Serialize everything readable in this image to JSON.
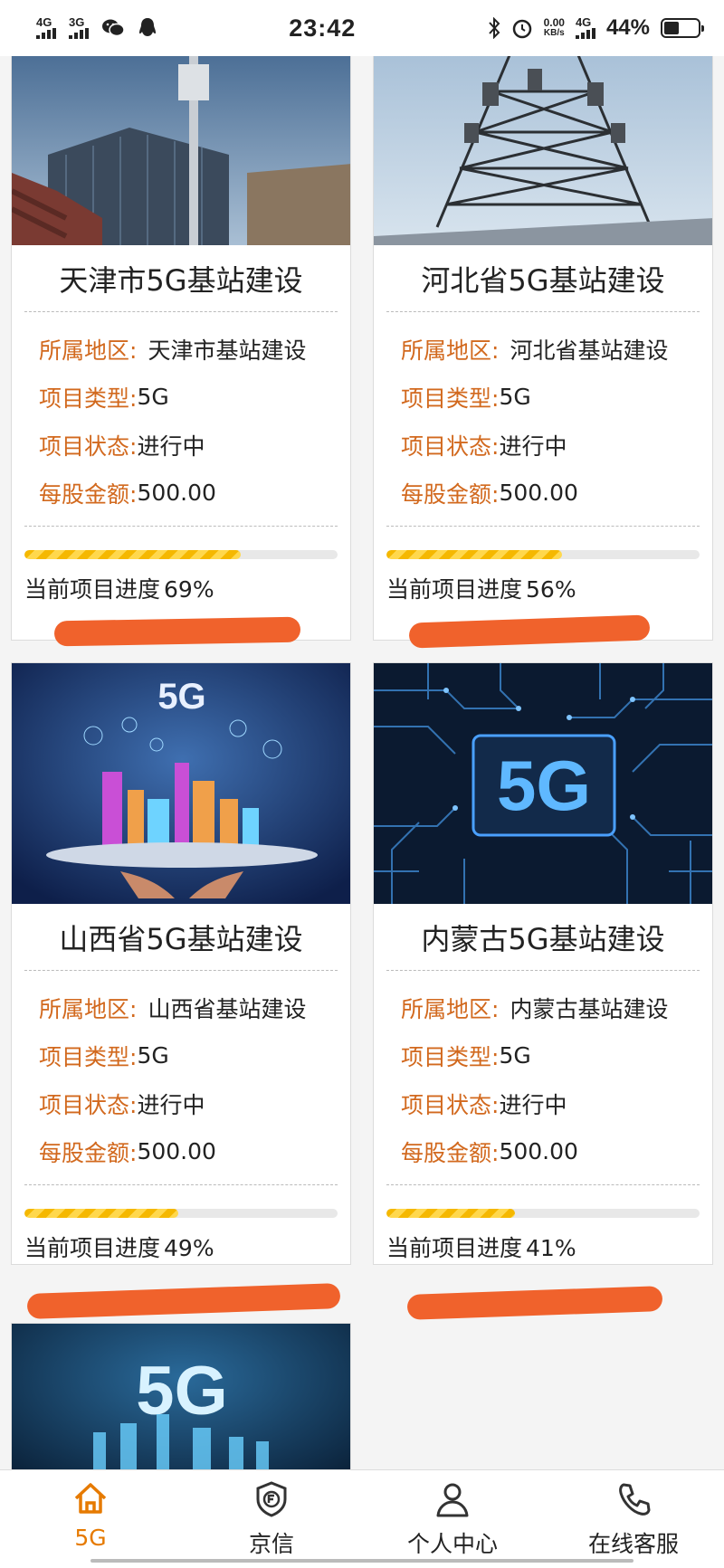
{
  "status_bar": {
    "net1": "4G",
    "net2": "3G",
    "time": "23:42",
    "speed_value": "0.00",
    "speed_unit": "KB/s",
    "net3": "4G",
    "battery": "44%"
  },
  "projects": [
    {
      "name": "天津市5G基站建设",
      "region_label": "所属地区:",
      "region": "天津市基站建设",
      "type_label": "项目类型:",
      "type": "5G",
      "status_label": "项目状态:",
      "status": "进行中",
      "price_label": "每股金额:",
      "price": "500.00",
      "progress_label": "当前项目进度",
      "progress": "69%",
      "progress_value": 69
    },
    {
      "name": "河北省5G基站建设",
      "region_label": "所属地区:",
      "region": "河北省基站建设",
      "type_label": "项目类型:",
      "type": "5G",
      "status_label": "项目状态:",
      "status": "进行中",
      "price_label": "每股金额:",
      "price": "500.00",
      "progress_label": "当前项目进度",
      "progress": "56%",
      "progress_value": 56
    },
    {
      "name": "山西省5G基站建设",
      "region_label": "所属地区:",
      "region": "山西省基站建设",
      "type_label": "项目类型:",
      "type": "5G",
      "status_label": "项目状态:",
      "status": "进行中",
      "price_label": "每股金额:",
      "price": "500.00",
      "progress_label": "当前项目进度",
      "progress": "49%",
      "progress_value": 49
    },
    {
      "name": "内蒙古5G基站建设",
      "region_label": "所属地区:",
      "region": "内蒙古基站建设",
      "type_label": "项目类型:",
      "type": "5G",
      "status_label": "项目状态:",
      "status": "进行中",
      "price_label": "每股金额:",
      "price": "500.00",
      "progress_label": "当前项目进度",
      "progress": "41%",
      "progress_value": 41
    }
  ],
  "image_text": {
    "badge_5g": "5G"
  },
  "tabbar": {
    "tabs": [
      {
        "label": "5G",
        "icon": "home-icon",
        "active": true
      },
      {
        "label": "京信",
        "icon": "shield-icon",
        "active": false
      },
      {
        "label": "个人中心",
        "icon": "person-icon",
        "active": false
      },
      {
        "label": "在线客服",
        "icon": "phone-icon",
        "active": false
      }
    ]
  },
  "colors": {
    "accent": "#e67a00",
    "label": "#d2691e",
    "progress": "#f5b800",
    "scribble": "#f0622c"
  }
}
